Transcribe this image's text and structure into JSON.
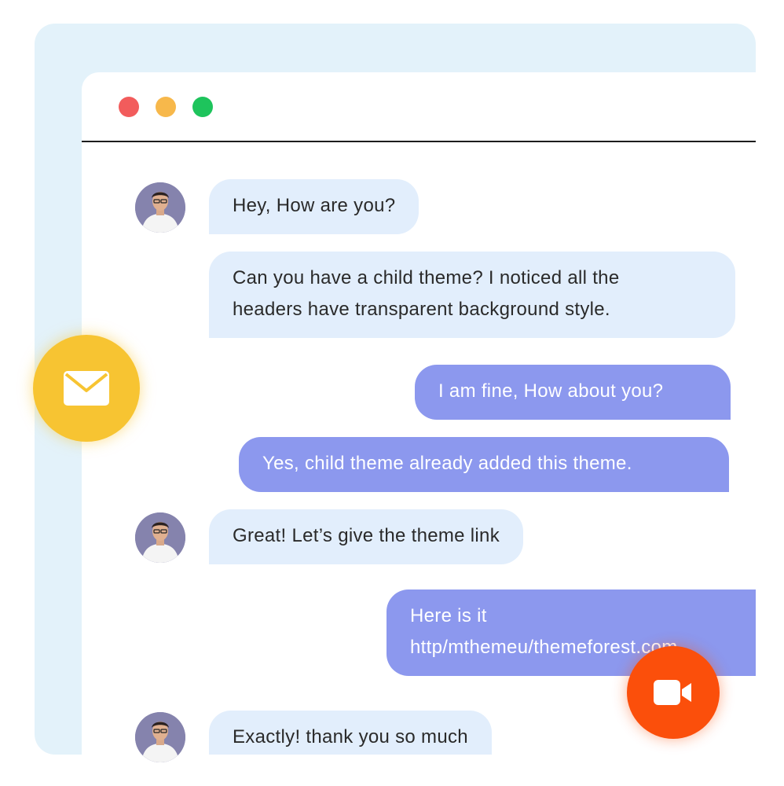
{
  "window": {
    "controls": [
      {
        "name": "close",
        "color": "#f25c5c"
      },
      {
        "name": "minimize",
        "color": "#f7b84b"
      },
      {
        "name": "maximize",
        "color": "#1ec45c"
      }
    ]
  },
  "chat": {
    "messages": [
      {
        "side": "incoming",
        "text": "Hey, How are you?"
      },
      {
        "side": "incoming",
        "lines": [
          "Can you have a child theme? I noticed all the",
          "headers have transparent background style."
        ]
      },
      {
        "side": "outgoing",
        "text": "I am fine, How about you?"
      },
      {
        "side": "outgoing",
        "text": "Yes, child theme already added this theme."
      },
      {
        "side": "incoming",
        "text": "Great! Let’s give the theme link"
      },
      {
        "side": "outgoing",
        "lines": [
          "Here is it",
          "http/mthemeu/themeforest.com"
        ]
      },
      {
        "side": "incoming",
        "text": "Exactly! thank you so much"
      }
    ]
  },
  "actions": {
    "mail_icon": "envelope-icon",
    "mail_color": "#f7c432",
    "video_icon": "video-camera-icon",
    "video_color": "#fb4f0b"
  },
  "colors": {
    "incoming_bubble": "#e2eefc",
    "outgoing_bubble": "#8c98ee",
    "backdrop": "#e3f2fa"
  }
}
